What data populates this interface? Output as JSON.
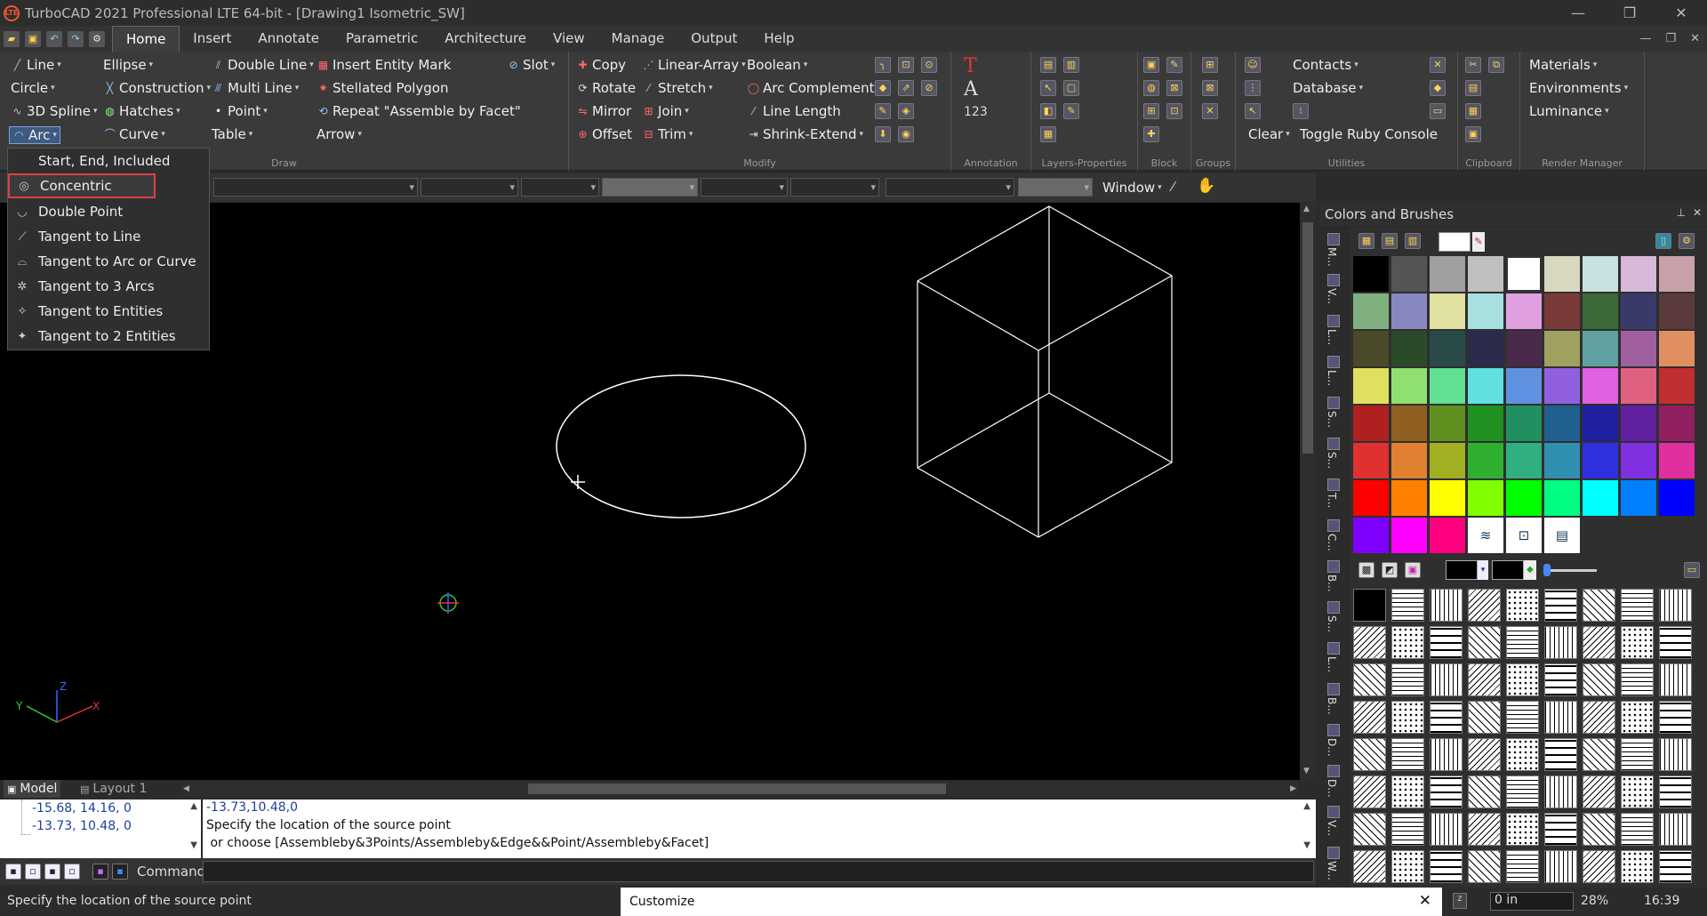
{
  "window": {
    "title": "TurboCAD 2021 Professional LTE 64-bit - [Drawing1 Isometric_SW]",
    "logo_text": "LTE"
  },
  "menu": {
    "tabs": [
      "Home",
      "Insert",
      "Annotate",
      "Parametric",
      "Architecture",
      "View",
      "Manage",
      "Output",
      "Help"
    ],
    "active": "Home"
  },
  "ribbon": {
    "draw": {
      "label": "Draw",
      "items": {
        "line": "Line",
        "ellipse": "Ellipse",
        "double_line": "Double Line",
        "insert_entity_mark": "Insert Entity Mark",
        "slot": "Slot",
        "circle": "Circle",
        "construction": "Construction",
        "multi_line": "Multi Line",
        "stellated_polygon": "Stellated Polygon",
        "spline_3d": "3D Spline",
        "hatches": "Hatches",
        "point": "Point",
        "repeat": "Repeat \"Assemble by Facet\"",
        "arc": "Arc",
        "curve": "Curve",
        "table": "Table",
        "arrow": "Arrow"
      }
    },
    "modify": {
      "label": "Modify",
      "items": {
        "copy": "Copy",
        "linear_array": "Linear-Array",
        "boolean": "Boolean",
        "rotate": "Rotate",
        "stretch": "Stretch",
        "arc_complement": "Arc Complement",
        "mirror": "Mirror",
        "join": "Join",
        "line_length": "Line Length",
        "offset": "Offset",
        "trim": "Trim",
        "shrink_extend": "Shrink-Extend"
      }
    },
    "annotation": {
      "label": "Annotation",
      "num_label": "123"
    },
    "layers": {
      "label": "Layers-Properties"
    },
    "block": {
      "label": "Block"
    },
    "groups": {
      "label": "Groups"
    },
    "utilities": {
      "label": "Utilities",
      "contacts": "Contacts",
      "database": "Database",
      "clear": "Clear",
      "toggle_ruby": "Toggle Ruby Console"
    },
    "clipboard": {
      "label": "Clipboard"
    },
    "render": {
      "label": "Render Manager",
      "materials": "Materials",
      "environments": "Environments",
      "luminance": "Luminance"
    }
  },
  "property_toolbar": {
    "window_label": "Window"
  },
  "arc_menu": {
    "items": [
      "Start, End, Included",
      "Concentric",
      "Double Point",
      "Tangent to Line",
      "Tangent to Arc or Curve",
      "Tangent to 3 Arcs",
      "Tangent to Entities",
      "Tangent to 2 Entities"
    ],
    "highlighted": "Concentric"
  },
  "layout_tabs": {
    "model": "Model",
    "layout1": "Layout 1"
  },
  "command": {
    "history": [
      "-15.68, 14.16, 0",
      "-13.73, 10.48, 0"
    ],
    "output_lines": [
      "-13.73,10.48,0",
      "Specify the location of the source point",
      " or choose [Assembleby&3Points/Assembleby&Edge&&Point/Assembleby&Facet]"
    ],
    "prompt_label": "Command:"
  },
  "status": {
    "message": "Specify the location of the source point",
    "customize": "Customize",
    "coord_value": "0 in",
    "zoom": "28%",
    "time": "16:39"
  },
  "palette": {
    "title": "Colors and Brushes",
    "side_tabs": [
      "M...",
      "V...",
      "L...",
      "L...",
      "S...",
      "S...",
      "T...",
      "C...",
      "B...",
      "S...",
      "L...",
      "B...",
      "D...",
      "D...",
      "V...",
      "W..."
    ],
    "colors": [
      "#000000",
      "#555555",
      "#a0a0a0",
      "#c0c0c0",
      "#ffffff",
      "#d8d8c0",
      "#c8e0e0",
      "#d8b8d8",
      "#c8a0a8",
      "#80b080",
      "#8888c0",
      "#e0e0a0",
      "#a8e0e0",
      "#e0a0e0",
      "#7a3a3a",
      "#3a6a3a",
      "#3a3a6a",
      "#5a3a3a",
      "#4a4a2a",
      "#2a4a2a",
      "#2a4a4a",
      "#2a2a4a",
      "#4a2a4a",
      "#a0a060",
      "#60a0a0",
      "#a060a0",
      "#e09060",
      "#e0e060",
      "#90e070",
      "#60e090",
      "#60e0e0",
      "#6090e0",
      "#9060e0",
      "#e060e0",
      "#e06080",
      "#c03030",
      "#b02020",
      "#906020",
      "#609020",
      "#209020",
      "#209060",
      "#206090",
      "#2020a0",
      "#6020a0",
      "#902060",
      "#e03030",
      "#e08030",
      "#a0b020",
      "#30b030",
      "#30b080",
      "#3090b0",
      "#3030e0",
      "#8030e0",
      "#e030a0",
      "#ff0000",
      "#ff8000",
      "#ffff00",
      "#80ff00",
      "#00ff00",
      "#00ff80",
      "#00ffff",
      "#0080ff",
      "#0000ff",
      "#8000ff",
      "#ff00ff",
      "#ff0080"
    ]
  }
}
